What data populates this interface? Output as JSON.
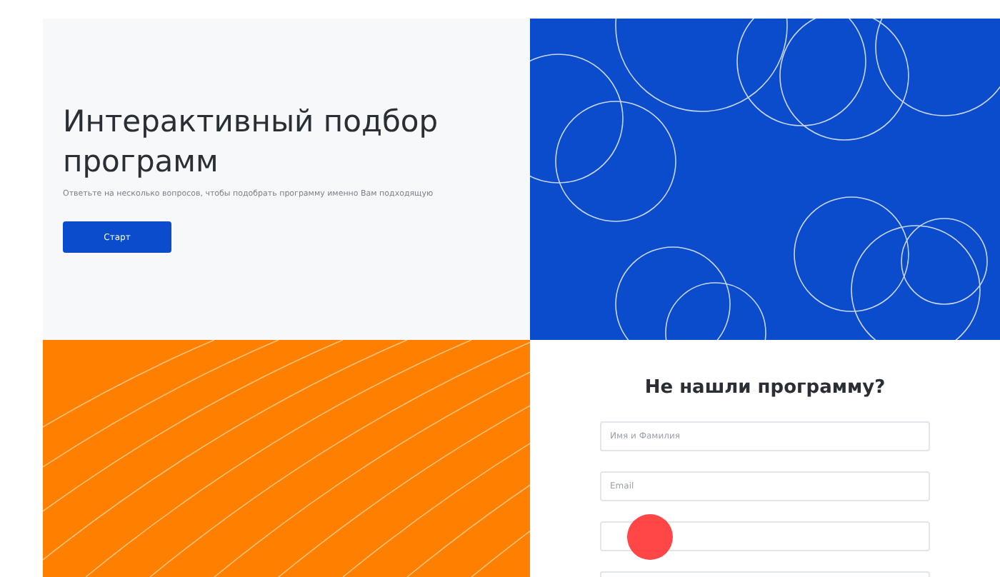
{
  "hero": {
    "title": "Интерактивный подбор программ",
    "subtitle": "Ответьте на несколько вопросов, чтобы подобрать программу именно Вам подходящую",
    "button": "Старт"
  },
  "form": {
    "title": "Не нашли программу?",
    "fields": [
      {
        "kind": "input",
        "placeholder": "Имя и Фамилия"
      },
      {
        "kind": "input",
        "placeholder": "Email"
      },
      {
        "kind": "input"
      },
      {
        "kind": "input"
      }
    ]
  }
}
